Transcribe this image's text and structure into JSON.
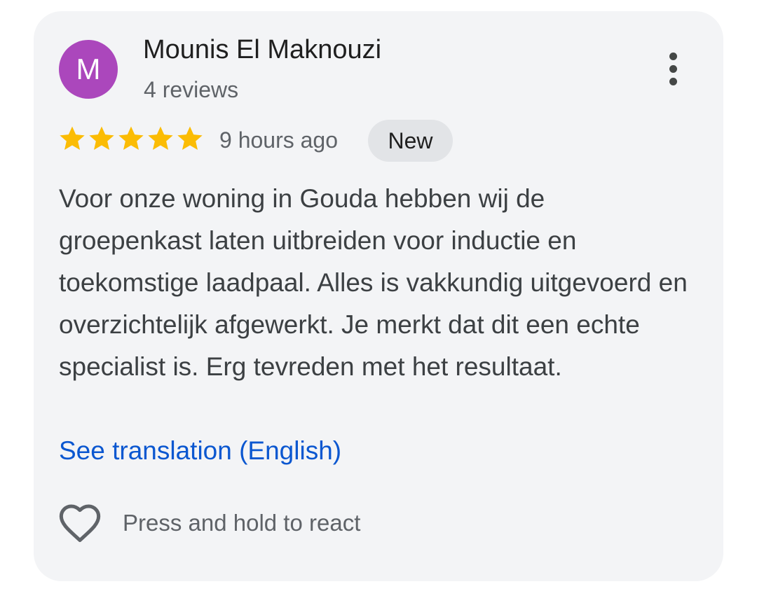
{
  "review": {
    "avatar_initial": "M",
    "avatar_color": "#ab47bc",
    "author_name": "Mounis El Maknouzi",
    "review_count": "4 reviews",
    "rating": 5,
    "rating_max": 5,
    "star_color": "#fbbc04",
    "star_icon": "star-icon",
    "timestamp": "9 hours ago",
    "badge": "New",
    "text": "Voor onze woning in Gouda hebben wij de groepenkast laten uitbreiden voor inductie en toekomstige laadpaal. Alles is vakkundig uitgevoerd en overzichtelijk afgewerkt. Je merkt dat dit een echte specialist is. Erg tevreden met het resultaat.",
    "translate_link": "See translation (English)",
    "link_color": "#0b57d0",
    "more_icon": "more-vertical-icon",
    "react_icon": "heart-outline-icon",
    "react_label": "Press and hold to react"
  }
}
